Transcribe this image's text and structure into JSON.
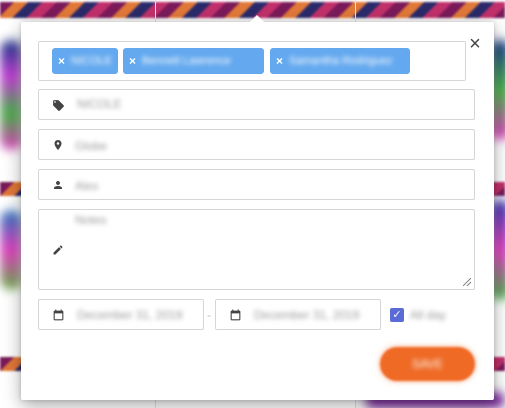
{
  "dialog": {
    "close_label": "×",
    "chips": [
      {
        "remove_label": "×",
        "label": "NICOLE"
      },
      {
        "remove_label": "×",
        "label": "Bennett Lawrence"
      },
      {
        "remove_label": "×",
        "label": "Samantha Rodriguez"
      }
    ],
    "tag_value": "NICOLE",
    "location_value": "Globe",
    "user_value": "Alex",
    "notes_placeholder": "Notes",
    "start_date": "December 31, 2019",
    "date_separator": "-",
    "end_date": "December 31, 2019",
    "all_day_checked": true,
    "all_day_label": "All day",
    "save_label": "SAVE"
  },
  "colors": {
    "chip_bg": "#64a9ef",
    "save_bg": "#ef6a25",
    "checkbox": "#5b6bd6"
  }
}
